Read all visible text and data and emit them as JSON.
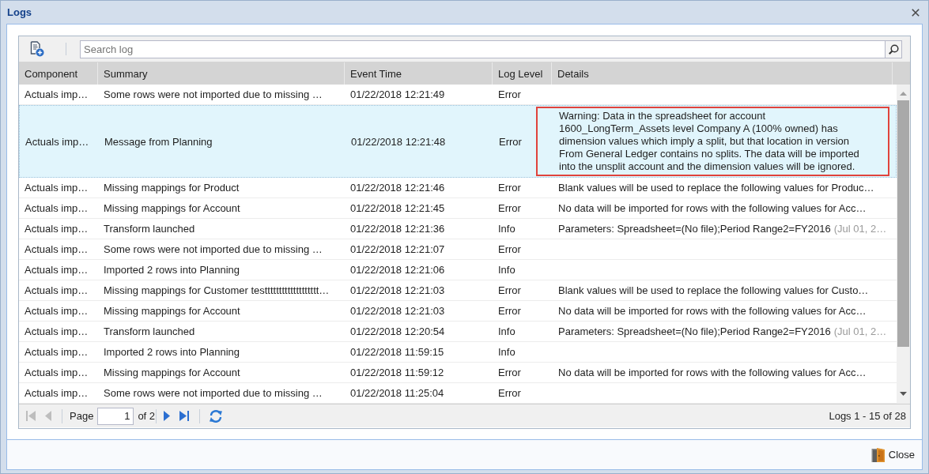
{
  "window": {
    "title": "Logs"
  },
  "toolbar": {
    "search": {
      "placeholder": "Search log"
    }
  },
  "table": {
    "columns": [
      "Component",
      "Summary",
      "Event Time",
      "Log Level",
      "Details"
    ],
    "rows": [
      {
        "component": "Actuals imp…",
        "summary": "Some rows were not imported due to missing …",
        "event_time": "01/22/2018 12:21:49",
        "log_level": "Error",
        "selected": false,
        "highlighted": false
      },
      {
        "component": "Actuals imp…",
        "summary": "Message from Planning",
        "event_time": "01/22/2018 12:21:48",
        "log_level": "Error",
        "details": "Warning: Data in the spreadsheet for account 1600_LongTerm_Assets level Company A (100% owned) has dimension values which imply a split, but that location in version From General Ledger contains no splits. The data will be imported into the unsplit account and the dimension values will be ignored.",
        "selected": true,
        "highlighted": true
      },
      {
        "component": "Actuals imp…",
        "summary": "Missing mappings for Product",
        "event_time": "01/22/2018 12:21:46",
        "log_level": "Error",
        "details": "Blank values will be used to replace the following values for Produc…",
        "selected": false,
        "highlighted": false
      },
      {
        "component": "Actuals imp…",
        "summary": "Missing mappings for Account",
        "event_time": "01/22/2018 12:21:45",
        "log_level": "Error",
        "details": "No data will be imported for rows with the following values for Acc…",
        "selected": false,
        "highlighted": false
      },
      {
        "component": "Actuals imp…",
        "summary": "Transform launched",
        "event_time": "01/22/2018 12:21:36",
        "log_level": "Info",
        "details": "Parameters: Spreadsheet=(No file);Period Range2=FY2016",
        "details_note": "(Jul 01, 2…",
        "selected": false,
        "highlighted": false
      },
      {
        "component": "Actuals imp…",
        "summary": "Some rows were not imported due to missing …",
        "event_time": "01/22/2018 12:21:07",
        "log_level": "Error",
        "selected": false,
        "highlighted": false
      },
      {
        "component": "Actuals imp…",
        "summary": "Imported 2 rows into Planning",
        "event_time": "01/22/2018 12:21:06",
        "log_level": "Info",
        "selected": false,
        "highlighted": false
      },
      {
        "component": "Actuals imp…",
        "summary": "Missing mappings for Customer testtttttttttttttttttt…",
        "event_time": "01/22/2018 12:21:03",
        "log_level": "Error",
        "details": "Blank values will be used to replace the following values for Custo…",
        "selected": false,
        "highlighted": false
      },
      {
        "component": "Actuals imp…",
        "summary": "Missing mappings for Account",
        "event_time": "01/22/2018 12:21:03",
        "log_level": "Error",
        "details": "No data will be imported for rows with the following values for Acc…",
        "selected": false,
        "highlighted": false
      },
      {
        "component": "Actuals imp…",
        "summary": "Transform launched",
        "event_time": "01/22/2018 12:20:54",
        "log_level": "Info",
        "details": "Parameters: Spreadsheet=(No file);Period Range2=FY2016",
        "details_note": "(Jul 01, 2…",
        "selected": false,
        "highlighted": false
      },
      {
        "component": "Actuals imp…",
        "summary": "Imported 2 rows into Planning",
        "event_time": "01/22/2018 11:59:15",
        "log_level": "Info",
        "selected": false,
        "highlighted": false
      },
      {
        "component": "Actuals imp…",
        "summary": "Missing mappings for Account",
        "event_time": "01/22/2018 11:59:12",
        "log_level": "Error",
        "details": "No data will be imported for rows with the following values for Acc…",
        "selected": false,
        "highlighted": false
      },
      {
        "component": "Actuals imp…",
        "summary": "Some rows were not imported due to missing …",
        "event_time": "01/22/2018 11:25:04",
        "log_level": "Error",
        "selected": false,
        "highlighted": false
      }
    ]
  },
  "pager": {
    "back_buttons": [
      {
        "kind": "first",
        "disabled": true
      },
      {
        "kind": "previous",
        "disabled": true
      }
    ],
    "page_label": "Page",
    "page": "1",
    "page_count": "of 2",
    "forward_buttons": [
      {
        "kind": "next",
        "disabled": false
      },
      {
        "kind": "last",
        "disabled": false
      }
    ],
    "summary": "Logs 1 - 15 of 28"
  },
  "footer": {
    "close_label": "Close"
  }
}
